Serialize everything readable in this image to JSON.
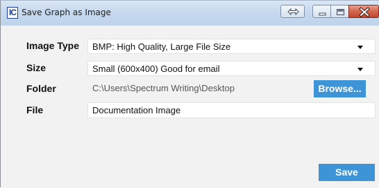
{
  "window": {
    "title": "Save Graph as Image",
    "app_icon_text": "IC"
  },
  "form": {
    "image_type": {
      "label": "Image Type",
      "value": "BMP: High Quality, Large File Size"
    },
    "size": {
      "label": "Size",
      "value": "Small (600x400) Good for email"
    },
    "folder": {
      "label": "Folder",
      "value": "C:\\Users\\Spectrum Writing\\Desktop",
      "browse_label": "Browse..."
    },
    "file": {
      "label": "File",
      "value": "Documentation Image"
    }
  },
  "actions": {
    "save_label": "Save"
  },
  "colors": {
    "accent_button": "#3d95d8",
    "close_button": "#c0482f",
    "titlebar": "#c7d9ee"
  }
}
